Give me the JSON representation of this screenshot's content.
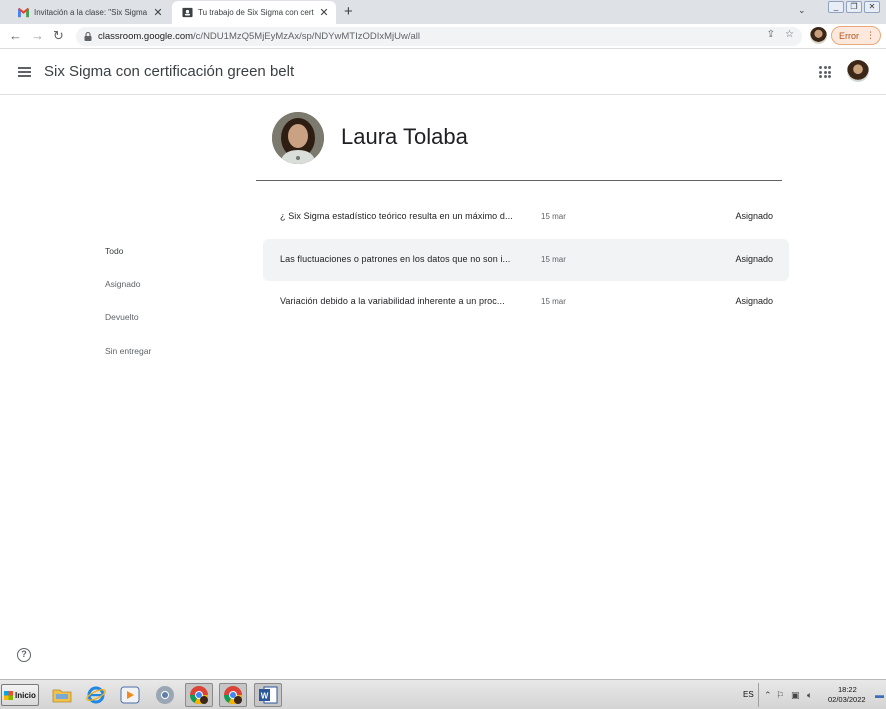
{
  "browser": {
    "tabs": [
      {
        "title": "Invitación a la clase: \"Six Sigma con",
        "icon": "gmail-icon"
      },
      {
        "title": "Tu trabajo de Six Sigma con certifica",
        "icon": "classroom-icon"
      }
    ],
    "url_host": "classroom.google.com",
    "url_path": "/c/NDU1MzQ5MjEyMzAx/sp/NDYwMTIzODIxMjUw/all",
    "error_label": "Error"
  },
  "classroom": {
    "class_name": "Six Sigma con certificación green belt",
    "student_name": "Laura Tolaba",
    "filters": [
      "Todo",
      "Asignado",
      "Devuelto",
      "Sin entregar"
    ],
    "assignments": [
      {
        "title": "¿ Six Sigma estadístico teórico resulta en un máximo d...",
        "date": "15 mar",
        "status": "Asignado"
      },
      {
        "title": "Las fluctuaciones o patrones en los datos que no son i...",
        "date": "15 mar",
        "status": "Asignado"
      },
      {
        "title": "Variación debido a la variabilidad inherente a un proc...",
        "date": "15 mar",
        "status": "Asignado"
      }
    ]
  },
  "taskbar": {
    "start_label": "Inicio",
    "language": "ES",
    "time": "18:22",
    "date": "02/03/2022"
  },
  "colors": {
    "tab_strip": "#dee1e6",
    "row_hover": "#f1f3f4",
    "error_chip": "#fce8dc"
  }
}
